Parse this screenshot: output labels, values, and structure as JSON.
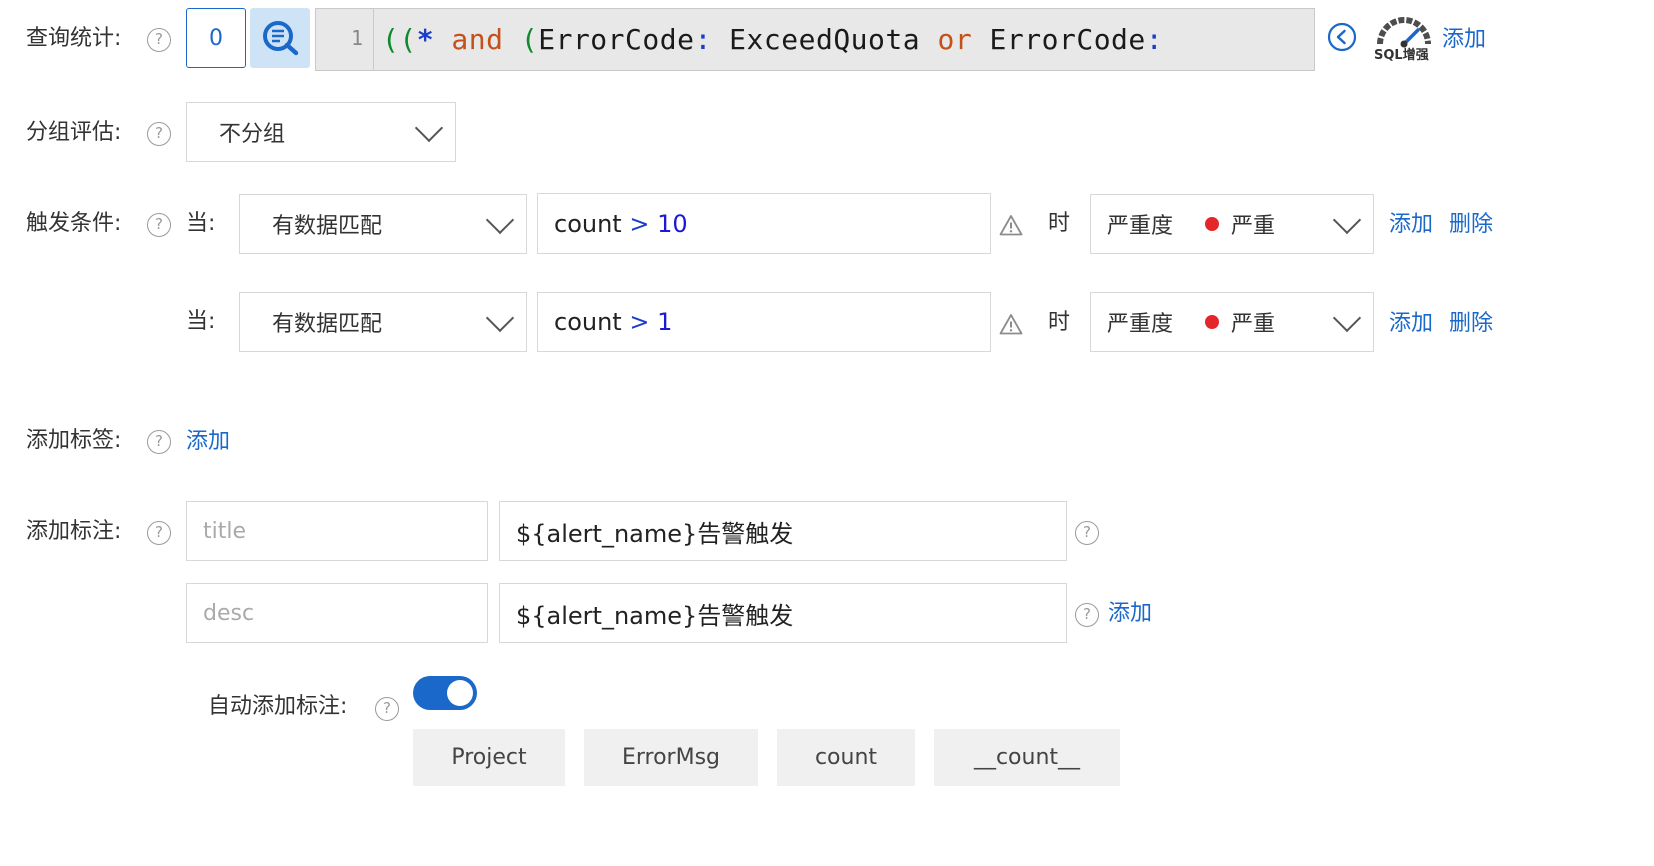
{
  "query_stats": {
    "label": "查询统计:",
    "count_value": "0",
    "line_number": "1",
    "code_tokens": [
      "((",
      "*",
      " and ",
      "(",
      "ErrorCode",
      ":",
      " ExceedQuota ",
      "or",
      " ErrorCode",
      ":"
    ],
    "sql_badge": "SQL增强",
    "add_link": "添加"
  },
  "group_eval": {
    "label": "分组评估:",
    "selected": "不分组"
  },
  "trigger": {
    "label": "触发条件:",
    "rows": [
      {
        "when": "当:",
        "match": "有数据匹配",
        "field": "count",
        "op": ">",
        "value": "10",
        "time": "时",
        "severity_label": "严重度",
        "severity_value": "严重",
        "add": "添加",
        "delete": "删除"
      },
      {
        "when": "当:",
        "match": "有数据匹配",
        "field": "count",
        "op": ">",
        "value": "1",
        "time": "时",
        "severity_label": "严重度",
        "severity_value": "严重",
        "add": "添加",
        "delete": "删除"
      }
    ]
  },
  "add_tag": {
    "label": "添加标签:",
    "link": "添加"
  },
  "annotation": {
    "label": "添加标注:",
    "rows": [
      {
        "key_placeholder": "title",
        "value": "${alert_name}告警触发"
      },
      {
        "key_placeholder": "desc",
        "value": "${alert_name}告警触发"
      }
    ],
    "add_link": "添加"
  },
  "auto_annotation": {
    "label": "自动添加标注:",
    "enabled": true,
    "tags": [
      "Project",
      "ErrorMsg",
      "count",
      "__count__"
    ]
  },
  "colors": {
    "link": "#1a68c9",
    "severity_red": "#e4262b",
    "toggle_on": "#1a68c9"
  }
}
